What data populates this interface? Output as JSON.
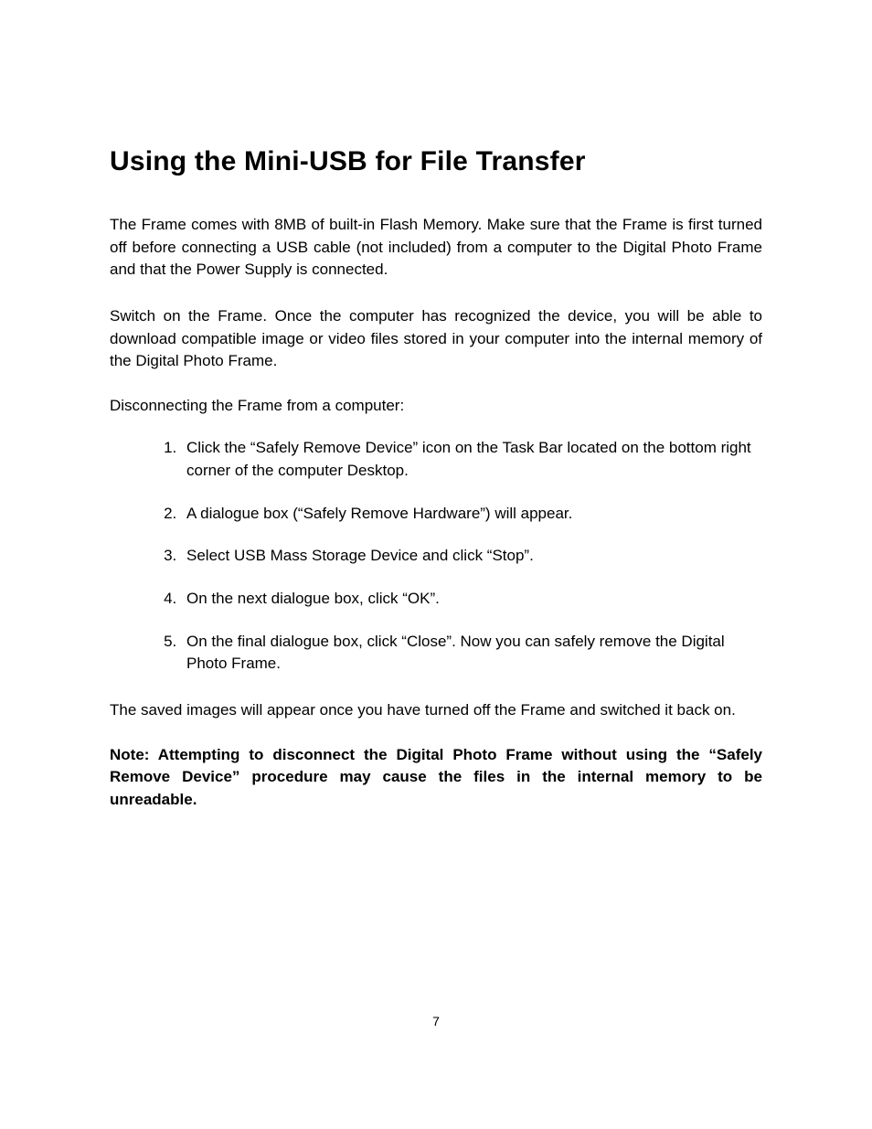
{
  "title": "Using the Mini-USB for File Transfer",
  "para1": "The Frame comes with 8MB of built-in Flash Memory. Make sure that the Frame is first turned off before connecting a USB cable (not included) from a computer to the Digital Photo Frame and that the Power Supply is connected.",
  "para2": "Switch on the Frame. Once the computer has recognized the device, you will be able to download compatible image or video files stored in your computer into the internal memory of the Digital Photo Frame.",
  "para3": "Disconnecting the Frame from a computer:",
  "steps": [
    "Click the “Safely Remove Device” icon on the Task Bar located on the bottom right corner of the computer Desktop.",
    "A dialogue box (“Safely Remove Hardware”) will appear.",
    "Select USB Mass Storage Device and click “Stop”.",
    "On the next dialogue box, click “OK”.",
    "On the final dialogue box, click “Close”. Now you can safely remove the Digital Photo Frame."
  ],
  "para4": "The saved images will appear once you have turned off the Frame and switched it back on.",
  "note": "Note: Attempting to disconnect the Digital Photo Frame without using the “Safely Remove Device” procedure may cause the files in the internal memory to be unreadable.",
  "page_number": "7"
}
